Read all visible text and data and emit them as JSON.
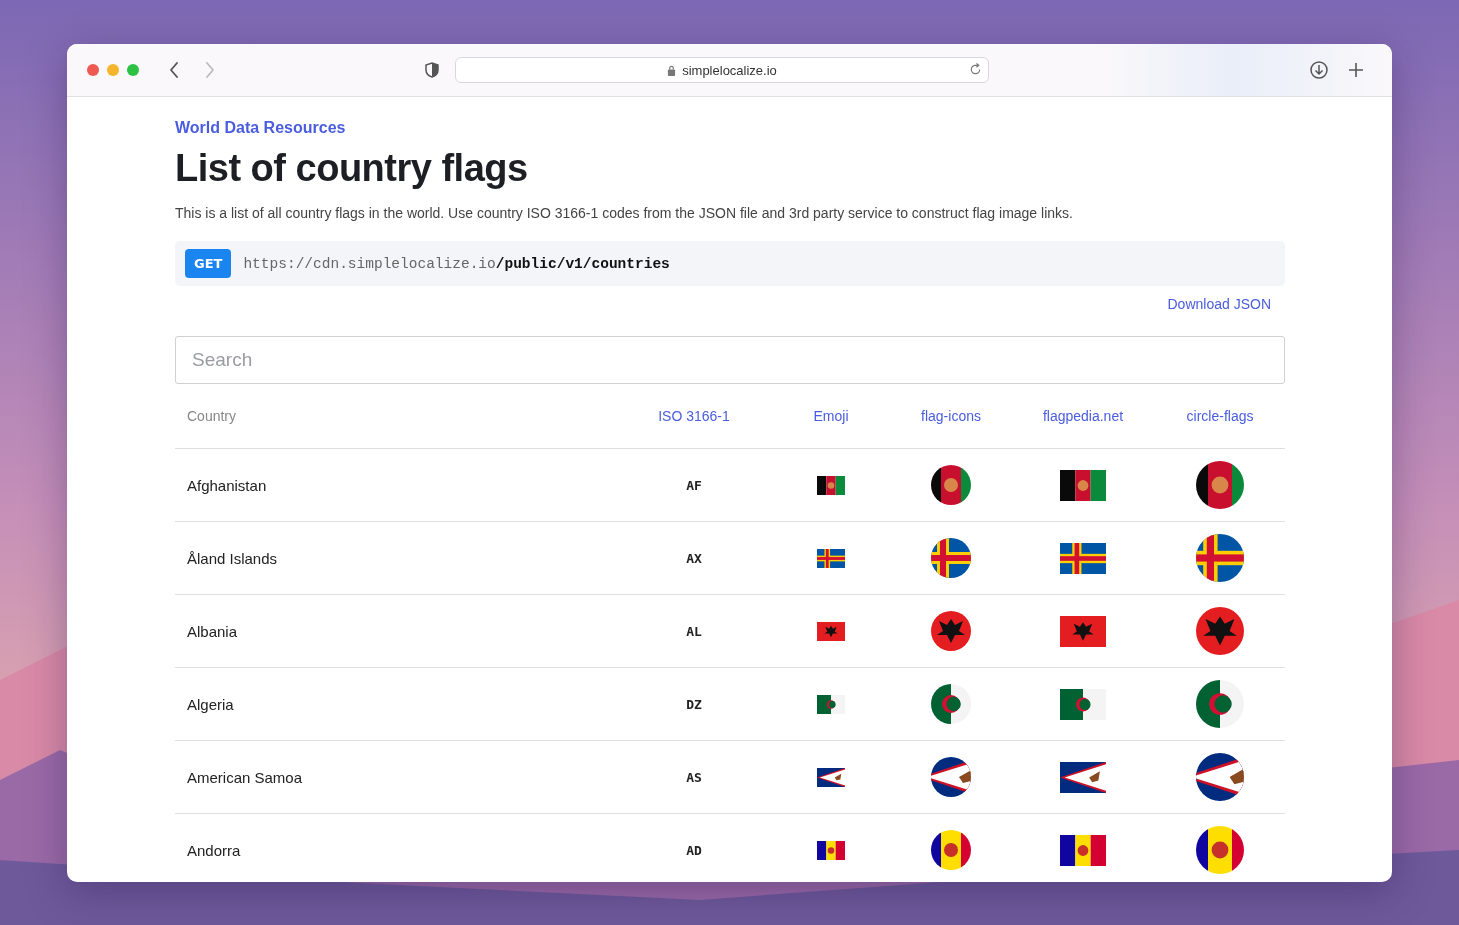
{
  "browser": {
    "address": "simplelocalize.io",
    "back_disabled": false,
    "forward_disabled": true
  },
  "page": {
    "breadcrumb": "World Data Resources",
    "title": "List of country flags",
    "description": "This is a list of all country flags in the world. Use country ISO 3166-1 codes from the JSON file and 3rd party service to construct flag image links.",
    "endpoint": {
      "method": "GET",
      "url": "https://cdn.simplelocalize.io**/public/v1/countries**"
    },
    "download_link": "Download JSON",
    "search": {
      "placeholder": "Search"
    }
  },
  "table": {
    "columns": [
      {
        "label": "Country",
        "kind": "label"
      },
      {
        "label": "ISO 3166-1",
        "kind": "link"
      },
      {
        "label": "Emoji",
        "kind": "link"
      },
      {
        "label": "flag-icons",
        "kind": "link"
      },
      {
        "label": "flagpedia.net",
        "kind": "link"
      },
      {
        "label": "circle-flags",
        "kind": "link"
      }
    ],
    "rows": [
      {
        "country": "Afghanistan",
        "iso": "AF"
      },
      {
        "country": "Åland Islands",
        "iso": "AX"
      },
      {
        "country": "Albania",
        "iso": "AL"
      },
      {
        "country": "Algeria",
        "iso": "DZ"
      },
      {
        "country": "American Samoa",
        "iso": "AS"
      },
      {
        "country": "Andorra",
        "iso": "AD"
      }
    ]
  }
}
